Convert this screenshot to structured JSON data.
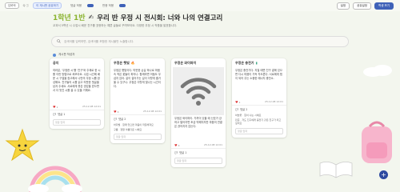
{
  "topbar": {
    "items": [
      "담벼락",
      "Q ⓘ",
      "이 게시판 공유하기"
    ],
    "toggles": [
      "",
      "댓글 허용",
      "반응 허용"
    ],
    "right": [
      "설정",
      "공유설정",
      "학생 보기"
    ]
  },
  "header": {
    "grade": "1학년 1반",
    "title": "우리 반 우정 시 전시회: 너와 나의 연결고리"
  },
  "subtitle": "교과서 5학년 시 수업시 배운 친구를 표현하는 예쁜 글들로 꾸며보아요. 다양한 우정 시 작품을 발표합니다.",
  "search": {
    "placeholder": "검색어를 입력하면, 검색어를 포함한 게시물만 노출합니다."
  },
  "author": "게시판 작성자",
  "cards": [
    {
      "title": "공지",
      "body": "여러분, '우정한 시'를 '친구'와 주제로 한 시를 이런 방법으로 써보아요. 수업 시간에 배운 시 구절을 참고해서 나만의 우정 시를 완성해요. 친구들의 시를 읽고 따뜻한 댓글을 남겨 주세요. 서로에게 좋은 영감을 받으면서 더 멋진 시를 쓸 수 있을 거예요.",
      "date": "25.12.08 12:01",
      "likes": "1",
      "comments": "댓글 1",
      "reply": "좋아요",
      "input": "댓글 입력"
    },
    {
      "title": "우정은 햇빛",
      "body": "우정은 햇빛이다. 따뜻한 손길 하나로 마음속 작은 꽃들이 피어나. 함께라면 어둠도 무섭지 않아. 같이 걸어가는 길이 이렇게 즐거울 수 있구나. 우정은 이렇게 빛나는 시간이다.",
      "date": "25.12.08 12:01",
      "likes": "4",
      "comments": "댓글 2",
      "c1": "바다별 · 함께 있으면 마음이 따뜻해져요",
      "c2": "구름 · 정말 아름다운 시예요",
      "input": "댓글 입력"
    },
    {
      "title": "우정은 와이파이",
      "body": "우정은 와이파이. 가까이 있을 때 신호가 강하고 멀어지면 조금 약해지지만 마음의 연결은 끊어지지 않는다.",
      "date": "25.12.08 12:01",
      "likes": "4",
      "comments": "댓글 1",
      "input": "댓글 입력"
    },
    {
      "title": "우정은 충전기",
      "body": "우정은 충전기다. 지칠 때면 친구 곁에 있으면 다시 마음이 가득 차오른다. 서로에게 힘이 되어 주는 소중한 에너지 충전소.",
      "date": "25.12.08 12:01",
      "likes": "1",
      "comments": "댓글 2",
      "c1": "하늘꽃 · 힘이 나는 시예요",
      "c2": "민준 · 저도 친구에게 충전기 같은 친구가 되고 싶어요",
      "input": "댓글 입력"
    }
  ],
  "fab": "+"
}
